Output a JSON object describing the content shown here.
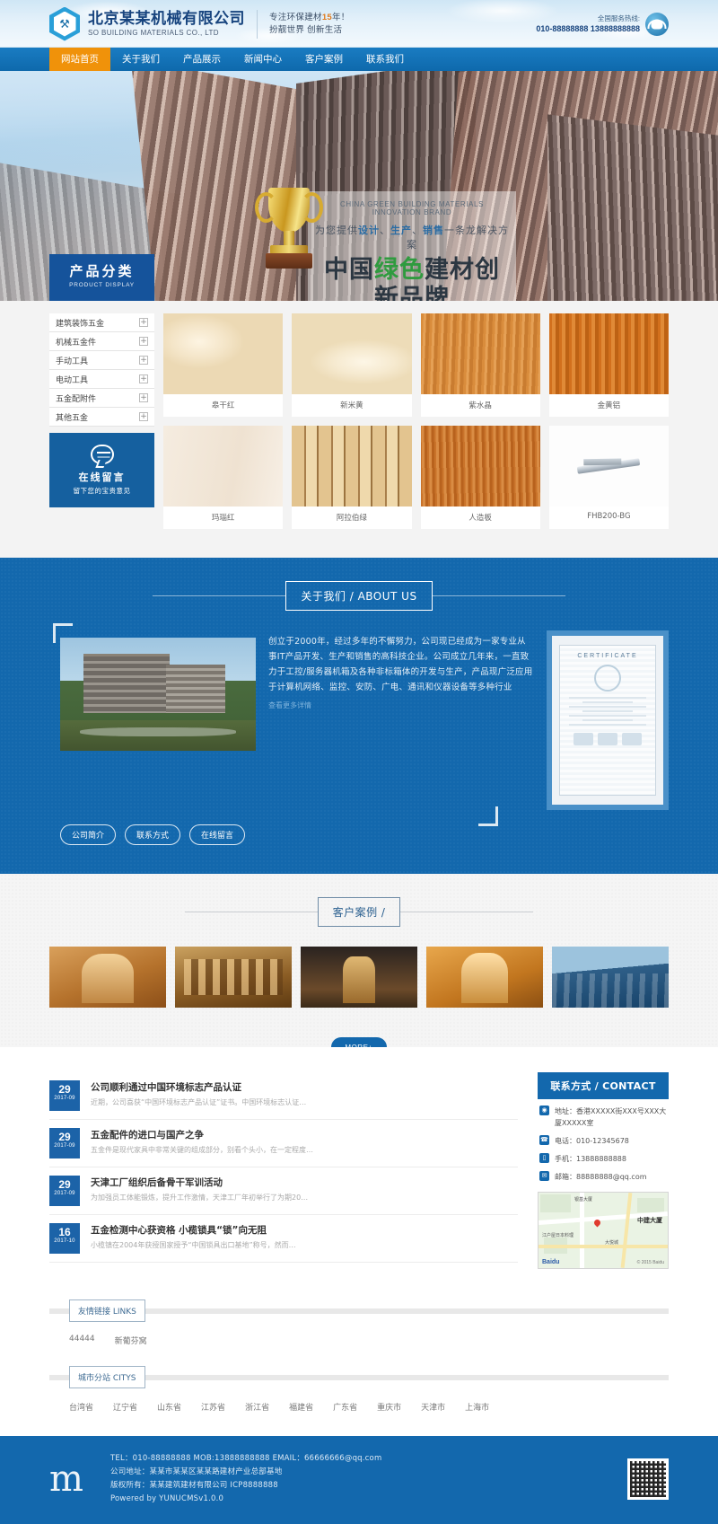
{
  "header": {
    "company_cn": "北京某某机械有限公司",
    "company_en": "SO BUILDING MATERIALS CO., LTD",
    "slogan_line1_pre": "专注环保建材",
    "slogan_line1_hl": "15",
    "slogan_line1_post": "年！",
    "slogan_line2": "扮靓世界 创新生活",
    "hotline_label": "全国服务热线:",
    "hotline_number": "010-88888888 13888888888",
    "logo_glyph": "⚒"
  },
  "nav": {
    "items": [
      {
        "label": "网站首页",
        "active": true
      },
      {
        "label": "关于我们",
        "active": false
      },
      {
        "label": "产品展示",
        "active": false
      },
      {
        "label": "新闻中心",
        "active": false
      },
      {
        "label": "客户案例",
        "active": false
      },
      {
        "label": "联系我们",
        "active": false
      }
    ]
  },
  "banner": {
    "english": "CHINA GREEN BUILDING MATERIALS INNOVATION BRAND",
    "sub_1": "为您提供",
    "sub_2": "设计",
    "sub_3": "、",
    "sub_4": "生产",
    "sub_5": "、",
    "sub_6": "销售",
    "sub_7": "一条龙解决方案",
    "main_1": "中国",
    "main_green": "绿色",
    "main_2": "建材创新品牌"
  },
  "category": {
    "title": "产品分类",
    "subtitle": "PRODUCT DISPLAY",
    "items": [
      {
        "label": "建筑装饰五金",
        "expand": "+"
      },
      {
        "label": "机械五金件",
        "expand": "+"
      },
      {
        "label": "手动工具",
        "expand": "+"
      },
      {
        "label": "电动工具",
        "expand": "+"
      },
      {
        "label": "五金配附件",
        "expand": "+"
      },
      {
        "label": "其他五金",
        "expand": "+"
      }
    ],
    "message_box": {
      "title": "在线留言",
      "subtitle": "留下您的宝贵意见"
    }
  },
  "products": {
    "row1": [
      {
        "name": "皋干红"
      },
      {
        "name": "新米黄"
      },
      {
        "name": "紫水晶"
      },
      {
        "name": "金黄铝"
      }
    ],
    "row2": [
      {
        "name": "玛瑙红"
      },
      {
        "name": "阿拉伯绿"
      },
      {
        "name": "人造板"
      },
      {
        "name": "FHB200-BG"
      }
    ]
  },
  "about": {
    "section_title": "关于我们 / ABOUT US",
    "text": "创立于2000年，经过多年的不懈努力，公司现已经成为一家专业从事IT产品开发、生产和销售的高科技企业。公司成立几年来，一直致力于工控/服务器机箱及各种非标箱体的开发与生产，产品现广泛应用于计算机网络、监控、安防、广电、通讯和仪器设备等多种行业",
    "more": "查看更多详情",
    "buttons": [
      "公司简介",
      "联系方式",
      "在线留言"
    ],
    "cert_title": "CERTIFICATE"
  },
  "cases": {
    "section_title": "客户案例 /",
    "more_label": "MORE+"
  },
  "news": {
    "items": [
      {
        "day": "29",
        "month": "2017-09",
        "title": "公司顺利通过中国环境标志产品认证",
        "desc": "近期，公司喜获“中国环境标志产品认证”证书。中国环境标志认证…"
      },
      {
        "day": "29",
        "month": "2017-09",
        "title": "五金配件的进口与国产之争",
        "desc": "五金件是现代家具中非常关键的组成部分，别看个头小，在一定程度…"
      },
      {
        "day": "29",
        "month": "2017-09",
        "title": "天津工厂组织后备骨干军训活动",
        "desc": "为加强员工体能锻炼，提升工作激情，天津工厂年初举行了为期20…"
      },
      {
        "day": "16",
        "month": "2017-10",
        "title": "五金检测中心获资格 小榄锁具“锁”向无阻",
        "desc": "小榄镇在2004年获授国家授予“中国锁具出口基地”称号，然而…"
      }
    ]
  },
  "contact": {
    "title": "联系方式 / CONTACT",
    "items": [
      {
        "icon": "location-icon",
        "glyph": "◉",
        "text": "地址：香港XXXXX街XXX号XXX大厦XXXXX室"
      },
      {
        "icon": "phone-icon",
        "glyph": "☎",
        "text": "电话：010-12345678"
      },
      {
        "icon": "mobile-icon",
        "glyph": "▯",
        "text": "手机：13888888888"
      },
      {
        "icon": "mail-icon",
        "glyph": "✉",
        "text": "邮箱：88888888@qq.com"
      }
    ],
    "map": {
      "labels": [
        "银基大厦",
        "中建大厦",
        "江户屋日本料理",
        "大悦城"
      ],
      "brand": "Baidu",
      "copyright": "© 2015 Baidu"
    }
  },
  "links": {
    "friend_title": "友情链接 LINKS",
    "friend_items": [
      "44444",
      "新葡芬窝"
    ],
    "city_title": "城市分站 CITYS",
    "city_items": [
      "台湾省",
      "辽宁省",
      "山东省",
      "江苏省",
      "浙江省",
      "福建省",
      "广东省",
      "重庆市",
      "天津市",
      "上海市"
    ]
  },
  "footer": {
    "logo_glyph": "m",
    "line1": "TEL：010-88888888 MOB:13888888888 EMAIL：66666666@qq.com",
    "line2": "公司地址：某某市某某区某某路建材产业总部基地",
    "line3": "版权所有：某某建筑建材有限公司 ICP8888888",
    "line4": "Powered by YUNUCMSv1.0.0"
  },
  "colors": {
    "brand_blue": "#1368ad",
    "nav_blue": "#1271b8",
    "accent_orange": "#f0920a",
    "dark_blue": "#15539b",
    "green": "#2f9b3f"
  }
}
